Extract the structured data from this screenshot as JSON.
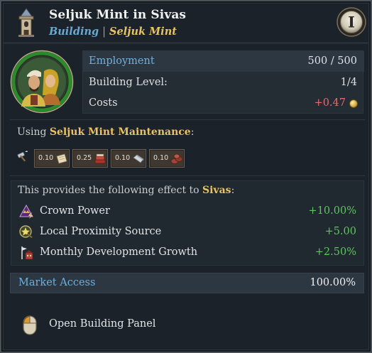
{
  "header": {
    "title": "Seljuk Mint in Sivas",
    "subtitle_type": "Building",
    "subtitle_separator": "|",
    "subtitle_name": "Seljuk Mint",
    "building_icon": "building-tower-icon",
    "info_button_icon": "info-roman-numeral-icon",
    "info_button_glyph": "I"
  },
  "stats": {
    "employment_label": "Employment",
    "employment_value": "500 / 500",
    "level_label": "Building Level:",
    "level_value": "1/4",
    "costs_label": "Costs",
    "costs_value": "+0.47",
    "costs_icon": "gold-coin-icon"
  },
  "maintenance": {
    "prefix": "Using ",
    "name": "Seljuk Mint Maintenance",
    "suffix": ":",
    "lead_icon": "hammer-icon",
    "goods": [
      {
        "value": "0.10",
        "icon": "paper-goods-icon"
      },
      {
        "value": "0.25",
        "icon": "books-goods-icon"
      },
      {
        "value": "0.10",
        "icon": "silver-goods-icon"
      },
      {
        "value": "0.10",
        "icon": "copper-goods-icon"
      }
    ]
  },
  "effects": {
    "head_prefix": "This provides the following effect to ",
    "head_location": "Sivas",
    "head_suffix": ":",
    "items": [
      {
        "label": "Crown Power",
        "value": "+10.00%",
        "icon": "crown-power-icon"
      },
      {
        "label": "Local Proximity Source",
        "value": "+5.00",
        "icon": "proximity-source-icon"
      },
      {
        "label": "Monthly Development Growth",
        "value": "+2.50%",
        "icon": "development-growth-icon"
      }
    ]
  },
  "market": {
    "label": "Market Access",
    "value": "100.00%"
  },
  "open_panel": {
    "label": "Open Building Panel",
    "icon": "mouse-click-icon"
  },
  "colors": {
    "link_blue": "#6fb0de",
    "highlight_gold": "#e8c365",
    "positive_green": "#5fc65e",
    "negative_red": "#e06f72",
    "panel_bg": "#1b2229"
  }
}
